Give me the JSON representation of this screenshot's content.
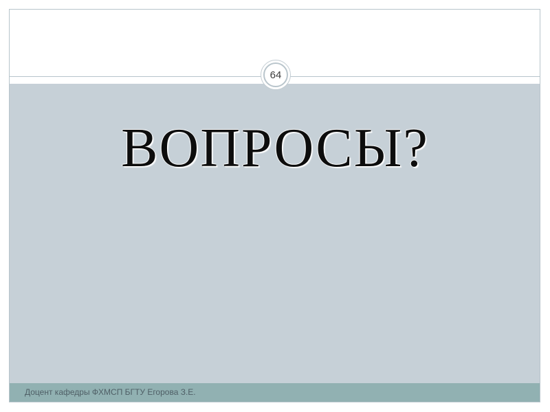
{
  "slide": {
    "page_number": "64",
    "title": "ВОПРОСЫ?",
    "footer": "Доцент кафедры ФХМСП БГТУ  Егорова З.Е."
  },
  "colors": {
    "content_background": "#c6d0d7",
    "footer_background": "#91b1b2",
    "frame_border": "#b7c4cb",
    "title_text": "#0d0d0d",
    "footer_text": "#4f5f66"
  }
}
